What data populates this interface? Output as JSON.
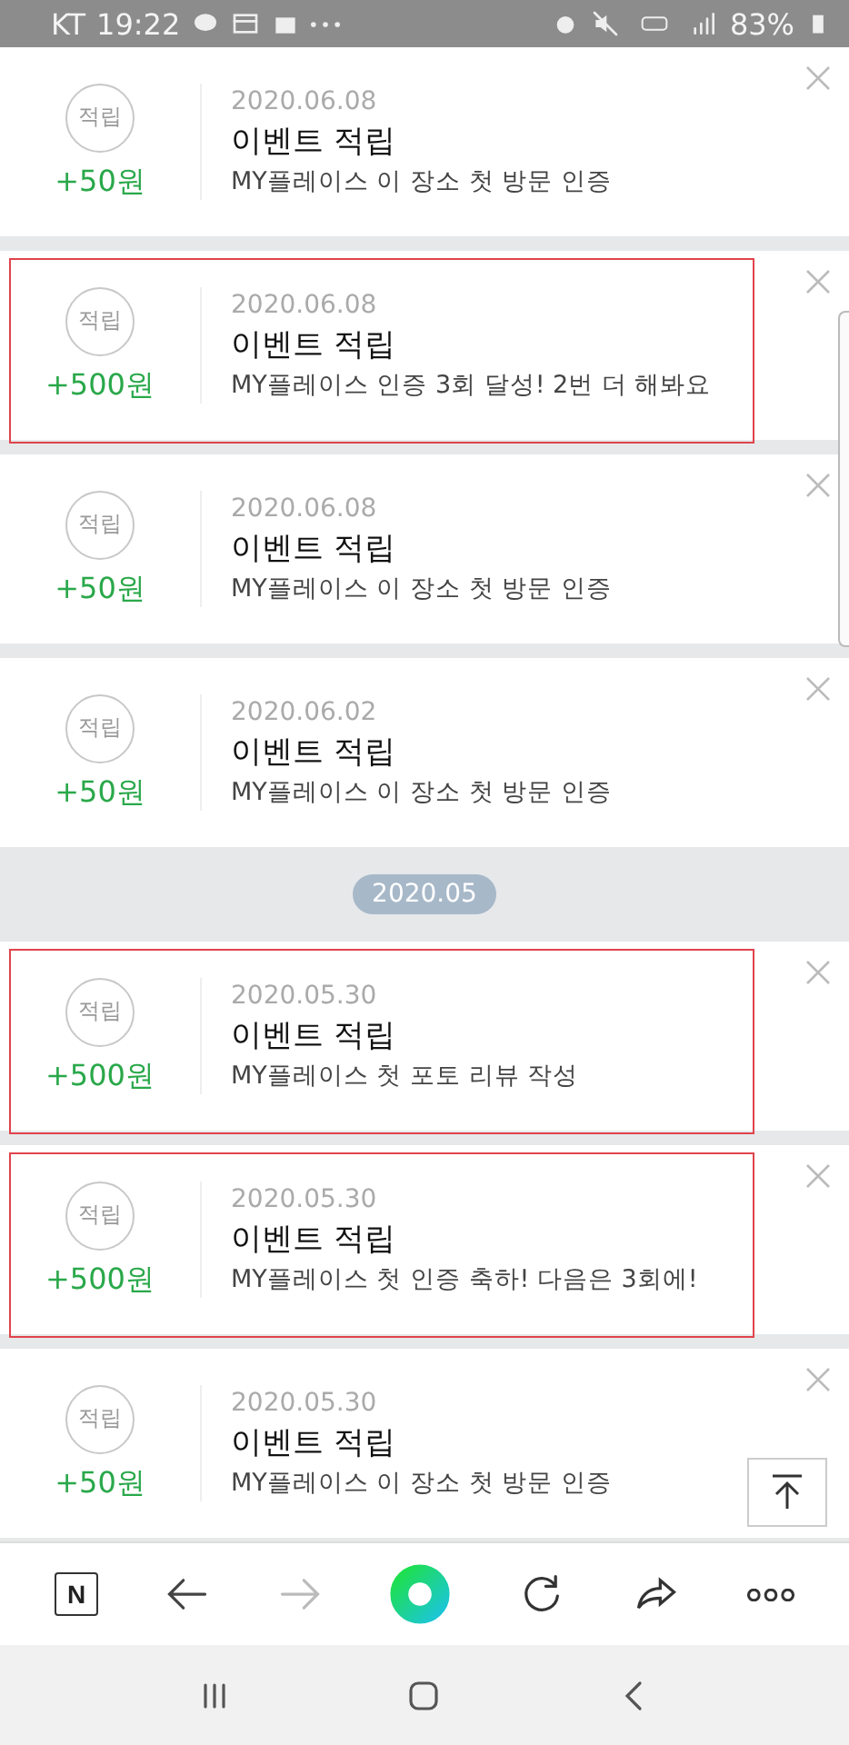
{
  "status_bar": {
    "carrier": "KT",
    "time": "19:22",
    "battery": "83%"
  },
  "sections": [
    {
      "items": [
        {
          "badge": "적립",
          "amount": "+50원",
          "date": "2020.06.08",
          "title": "이벤트 적립",
          "description": "MY플레이스 이 장소 첫 방문 인증",
          "highlighted": false
        },
        {
          "badge": "적립",
          "amount": "+500원",
          "date": "2020.06.08",
          "title": "이벤트 적립",
          "description": "MY플레이스 인증 3회 달성! 2번 더 해봐요",
          "highlighted": true
        },
        {
          "badge": "적립",
          "amount": "+50원",
          "date": "2020.06.08",
          "title": "이벤트 적립",
          "description": "MY플레이스 이 장소 첫 방문 인증",
          "highlighted": false
        },
        {
          "badge": "적립",
          "amount": "+50원",
          "date": "2020.06.02",
          "title": "이벤트 적립",
          "description": "MY플레이스 이 장소 첫 방문 인증",
          "highlighted": false
        }
      ]
    },
    {
      "header": "2020.05",
      "items": [
        {
          "badge": "적립",
          "amount": "+500원",
          "date": "2020.05.30",
          "title": "이벤트 적립",
          "description": "MY플레이스 첫 포토 리뷰 작성",
          "highlighted": true
        },
        {
          "badge": "적립",
          "amount": "+500원",
          "date": "2020.05.30",
          "title": "이벤트 적립",
          "description": "MY플레이스 첫 인증 축하! 다음은 3회에!",
          "highlighted": true
        },
        {
          "badge": "적립",
          "amount": "+50원",
          "date": "2020.05.30",
          "title": "이벤트 적립",
          "description": "MY플레이스 이 장소 첫 방문 인증",
          "highlighted": false
        }
      ]
    }
  ],
  "toolbar": {
    "home_label": "N",
    "forward_disabled": true
  }
}
